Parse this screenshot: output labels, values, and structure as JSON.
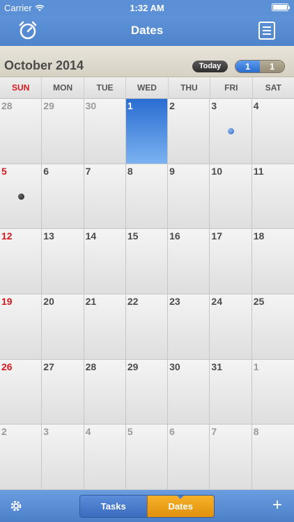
{
  "status": {
    "carrier": "Carrier",
    "time": "1:32 AM"
  },
  "nav": {
    "title": "Dates",
    "left_icon": "alarm-clock-icon",
    "right_icon": "list-icon"
  },
  "month": {
    "title": "October 2014",
    "today_label": "Today",
    "seg_left": "1",
    "seg_right": "1"
  },
  "weekdays": [
    "SUN",
    "MON",
    "TUE",
    "WED",
    "THU",
    "FRI",
    "SAT"
  ],
  "calendar": [
    {
      "day": "28",
      "other": true
    },
    {
      "day": "29",
      "other": true
    },
    {
      "day": "30",
      "other": true
    },
    {
      "day": "1",
      "today": true
    },
    {
      "day": "2"
    },
    {
      "day": "3",
      "dot": "blue"
    },
    {
      "day": "4"
    },
    {
      "day": "5",
      "dot": "dark"
    },
    {
      "day": "6"
    },
    {
      "day": "7"
    },
    {
      "day": "8"
    },
    {
      "day": "9"
    },
    {
      "day": "10"
    },
    {
      "day": "11"
    },
    {
      "day": "12"
    },
    {
      "day": "13"
    },
    {
      "day": "14"
    },
    {
      "day": "15"
    },
    {
      "day": "16"
    },
    {
      "day": "17"
    },
    {
      "day": "18"
    },
    {
      "day": "19"
    },
    {
      "day": "20"
    },
    {
      "day": "21"
    },
    {
      "day": "22"
    },
    {
      "day": "23"
    },
    {
      "day": "24"
    },
    {
      "day": "25"
    },
    {
      "day": "26"
    },
    {
      "day": "27"
    },
    {
      "day": "28"
    },
    {
      "day": "29"
    },
    {
      "day": "30"
    },
    {
      "day": "31"
    },
    {
      "day": "1",
      "other": true
    },
    {
      "day": "2",
      "other": true
    },
    {
      "day": "3",
      "other": true
    },
    {
      "day": "4",
      "other": true
    },
    {
      "day": "5",
      "other": true
    },
    {
      "day": "6",
      "other": true
    },
    {
      "day": "7",
      "other": true
    },
    {
      "day": "8",
      "other": true
    }
  ],
  "tabbar": {
    "tasks_label": "Tasks",
    "dates_label": "Dates",
    "left_icon": "gear-icon",
    "right_icon": "plus-icon",
    "plus_glyph": "+"
  },
  "colors": {
    "accent": "#5b8fd6",
    "today": "#2a6dd2",
    "sunday": "#d3191f",
    "dates_tab": "#f2a21b"
  }
}
